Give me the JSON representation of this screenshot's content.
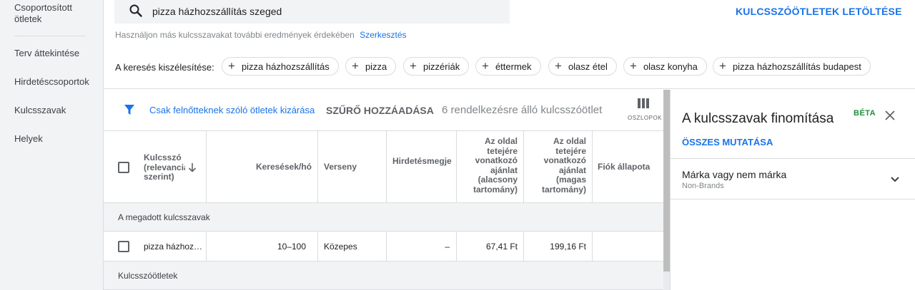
{
  "sidebar": {
    "items": [
      {
        "label": "Csoportosított"
      },
      {
        "label": "ötletek"
      },
      {
        "label": "Terv áttekintése"
      },
      {
        "label": "Hirdetéscsoportok"
      },
      {
        "label": "Kulcsszavak"
      },
      {
        "label": "Helyek"
      }
    ]
  },
  "search": {
    "value": "pizza házhozszállítás szeged",
    "icon": "search-icon"
  },
  "toolbar": {
    "download_label": "KULCSSZÓÖTLETEK LETÖLTÉSE",
    "hint": "Használjon más kulcsszavakat további eredmények érdekében",
    "hint_link": "Szerkesztés"
  },
  "broaden": {
    "label": "A keresés kiszélesítése:",
    "chips": [
      "pizza házhozszállítás",
      "pizza",
      "pizzériák",
      "éttermek",
      "olasz étel",
      "olasz konyha",
      "pizza házhozszállítás budapest"
    ]
  },
  "filters": {
    "adult_exclude": "Csak felnőtteknek szóló ötletek kizárása",
    "add_filter": "SZŰRŐ HOZZÁADÁSA",
    "available": "6 rendelkezésre álló kulcsszóötlet",
    "columns_label": "OSZLOPOK"
  },
  "table": {
    "headers": {
      "keyword": [
        "Kulcsszó",
        "(relevancia",
        "szerint)"
      ],
      "searches": "Keresések/hó",
      "competition": "Verseny",
      "impression_share": "Hirdetésmegje",
      "bid_low": [
        "Az oldal",
        "tetejére",
        "vonatkozó",
        "ajánlat",
        "(alacsony",
        "tartomány)"
      ],
      "bid_high": [
        "Az oldal",
        "tetejére",
        "vonatkozó",
        "ajánlat",
        "(magas",
        "tartomány)"
      ],
      "account_status": "Fiók állapota"
    },
    "group_provided": "A megadott kulcsszavak",
    "group_ideas": "Kulcsszóötletek",
    "rows": [
      {
        "keyword": "pizza házhoz…",
        "searches": "10–100",
        "competition": "Közepes",
        "impression_share": "–",
        "bid_low": "67,41 Ft",
        "bid_high": "199,16 Ft",
        "account_status": ""
      }
    ]
  },
  "panel": {
    "title": "A kulcsszavak finomítása",
    "badge": "BÉTA",
    "show_all": "ÖSSZES MUTATÁSA",
    "brand_title": "Márka vagy nem márka",
    "brand_sub": "Non-Brands"
  },
  "colors": {
    "accent": "#1a73e8",
    "badge": "#1e8e3e",
    "sidebar_bg": "#f1f3f4"
  }
}
